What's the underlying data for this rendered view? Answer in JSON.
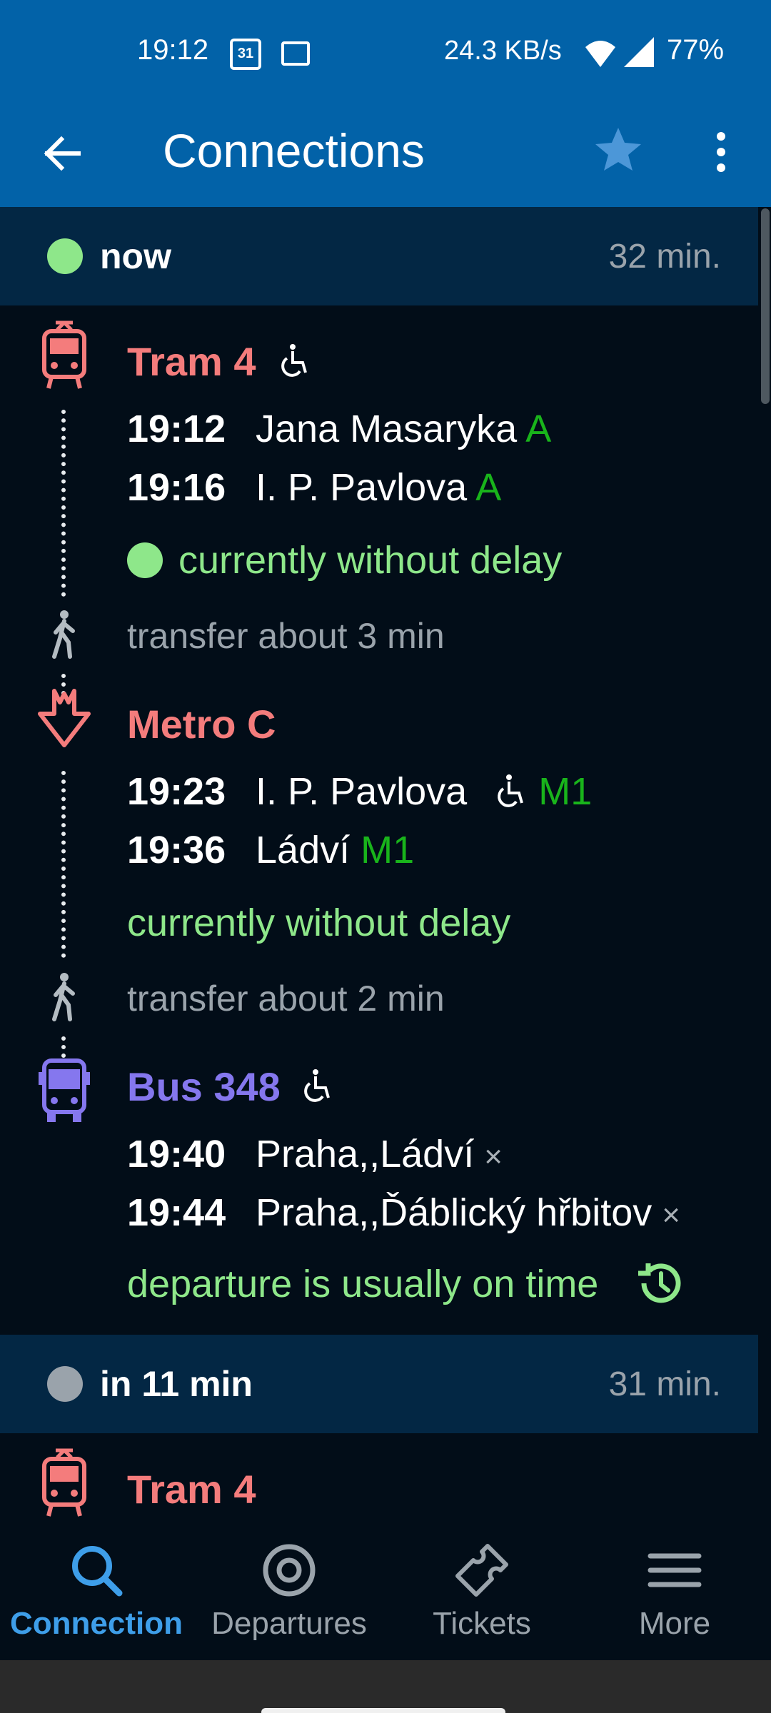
{
  "status_bar": {
    "time": "19:12",
    "calendar_day": "31",
    "net_speed": "24.3 KB/s",
    "battery": "77%"
  },
  "app_bar": {
    "title": "Connections"
  },
  "colors": {
    "appbar": "#0262a8",
    "header": "#032744",
    "background": "#020d18",
    "tram": "#f47c7c",
    "metro": "#f47c7c",
    "bus": "#8577ee",
    "on_time": "#8ee78a",
    "platform": "#19b41b",
    "active_nav": "#3e9ee9"
  },
  "connections": [
    {
      "status": "now",
      "status_color": "#8ee78a",
      "duration": "32 min.",
      "legs": [
        {
          "icon": "tram-icon",
          "line": "Tram 4",
          "wheelchair": true,
          "stops": [
            {
              "time": "19:12",
              "name": "Jana Masaryka",
              "platform": "A"
            },
            {
              "time": "19:16",
              "name": "I. P. Pavlova",
              "platform": "A"
            }
          ],
          "delay": "currently without delay"
        },
        {
          "transfer": "transfer about 3 min"
        },
        {
          "icon": "metro-icon",
          "line": "Metro C",
          "stops": [
            {
              "time": "19:23",
              "name": "I. P. Pavlova",
              "platform": "M1",
              "wheelchair": true
            },
            {
              "time": "19:36",
              "name": "Ládví",
              "platform": "M1"
            }
          ],
          "delay": "currently without delay"
        },
        {
          "transfer": "transfer about 2 min"
        },
        {
          "icon": "bus-icon",
          "line": "Bus 348",
          "wheelchair": true,
          "stops": [
            {
              "time": "19:40",
              "name": "Praha,,Ládví",
              "request_stop": "×"
            },
            {
              "time": "19:44",
              "name": "Praha,,Ďáblický hřbitov",
              "request_stop": "×"
            }
          ],
          "delay": "departure is usually on time"
        }
      ]
    },
    {
      "status": "in 11 min",
      "status_color": "#9aa3ab",
      "duration": "31 min.",
      "legs": [
        {
          "icon": "tram-icon",
          "line": "Tram 4"
        }
      ]
    }
  ],
  "bottom_nav": [
    {
      "label": "Connection",
      "icon": "search-icon",
      "active": true
    },
    {
      "label": "Departures",
      "icon": "target-icon",
      "active": false
    },
    {
      "label": "Tickets",
      "icon": "ticket-icon",
      "active": false
    },
    {
      "label": "More",
      "icon": "hamburger-icon",
      "active": false
    }
  ]
}
